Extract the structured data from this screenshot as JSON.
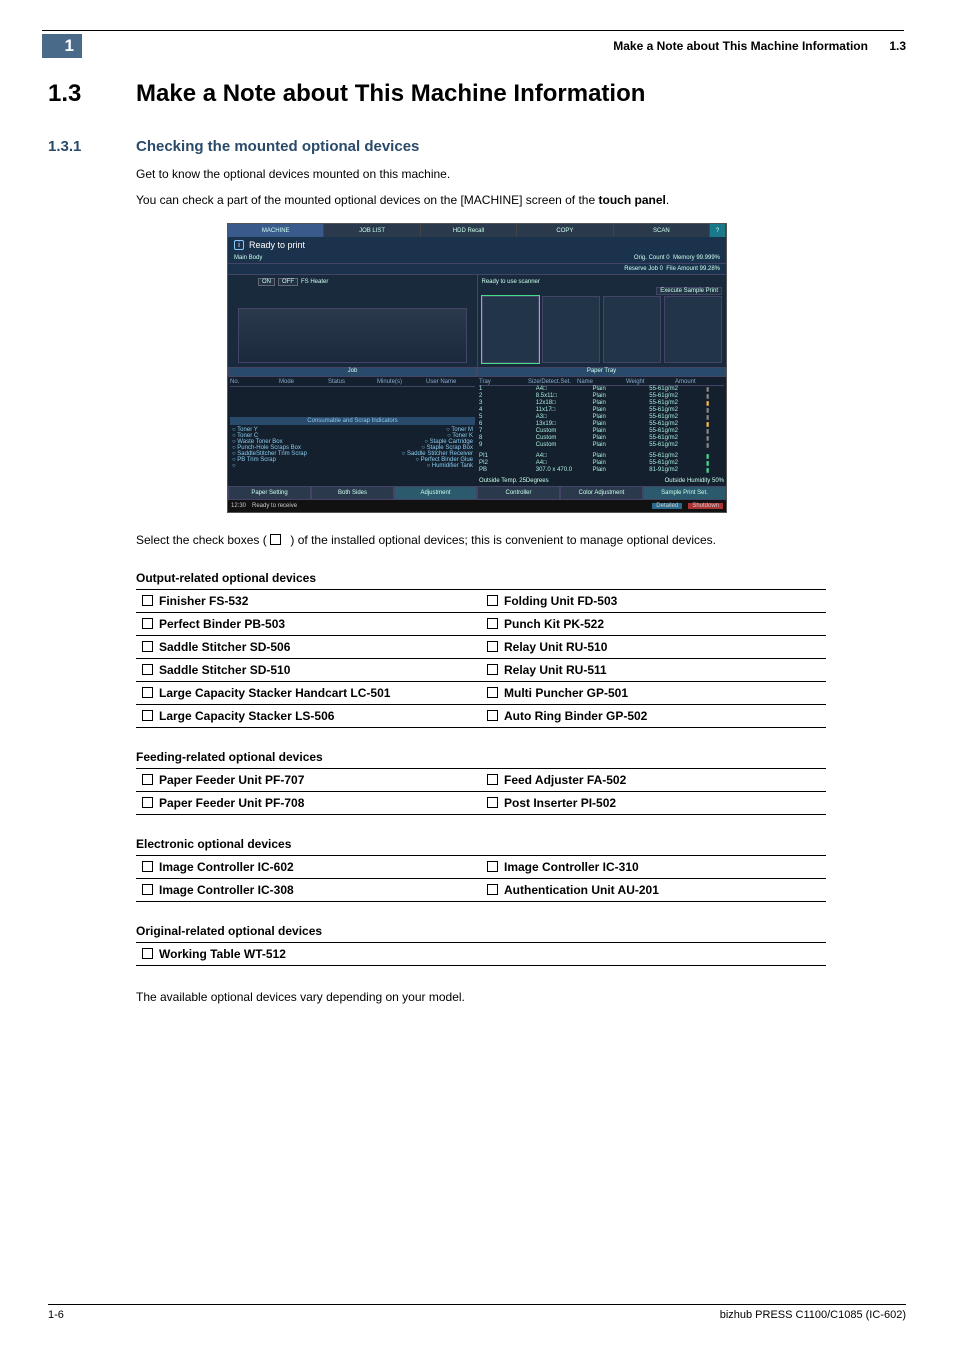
{
  "header": {
    "chapter_badge": "1",
    "running_title": "Make a Note about This Machine Information",
    "running_secnum": "1.3"
  },
  "h1": {
    "num": "1.3",
    "title": "Make a Note about This Machine Information"
  },
  "h2": {
    "num": "1.3.1",
    "title": "Checking the mounted optional devices"
  },
  "intro": {
    "p1": "Get to know the optional devices mounted on this machine.",
    "p2_a": "You can check a part of the mounted optional devices on the [MACHINE] screen of the ",
    "p2_bold": "touch panel",
    "p2_b": "."
  },
  "screenshot": {
    "tabs": [
      "MACHINE",
      "JOB LIST",
      "HDD Recall",
      "COPY",
      "SCAN"
    ],
    "help": "?",
    "ready_text": "Ready to print",
    "main_body_label": "Main Body",
    "orig_count_label": "Orig. Count",
    "orig_count_value": "0",
    "memory_label": "Memory",
    "memory_value": "99.999%",
    "reserve_job_label": "Reserve Job",
    "reserve_job_value": "0",
    "file_amount_label": "File Amount",
    "file_amount_value": "99.28%",
    "heater_label": "FS Heater",
    "heater_on": "ON",
    "heater_off": "OFF",
    "scanner_msg": "Ready to use scanner",
    "sample_btn": "Execute Sample Print",
    "job_header": "Job",
    "job_cols": [
      "No.",
      "Mode",
      "Status",
      "Minute(s)",
      "User Name"
    ],
    "paper_tray_header": "Paper Tray",
    "tray_cols": [
      "Tray",
      "Size/Detect.Set.",
      "Name",
      "Weight",
      "Amount"
    ],
    "trays": [
      {
        "n": "1",
        "size": "A4□",
        "name": "Plain",
        "wt": "55-61g/m2",
        "lvl": "gray"
      },
      {
        "n": "2",
        "size": "8.5x11□",
        "name": "Plain",
        "wt": "55-61g/m2",
        "lvl": "gray"
      },
      {
        "n": "3",
        "size": "12x18□",
        "name": "Plain",
        "wt": "55-61g/m2",
        "lvl": "warn"
      },
      {
        "n": "4",
        "size": "11x17□",
        "name": "Plain",
        "wt": "55-61g/m2",
        "lvl": "gray"
      },
      {
        "n": "5",
        "size": "A3□",
        "name": "Plain",
        "wt": "55-61g/m2",
        "lvl": "gray"
      },
      {
        "n": "6",
        "size": "13x19□",
        "name": "Plain",
        "wt": "55-61g/m2",
        "lvl": "warn"
      },
      {
        "n": "7",
        "size": "Custom",
        "name": "Plain",
        "wt": "55-61g/m2",
        "lvl": "gray"
      },
      {
        "n": "8",
        "size": "Custom",
        "name": "Plain",
        "wt": "55-61g/m2",
        "lvl": "gray"
      },
      {
        "n": "9",
        "size": "Custom",
        "name": "Plain",
        "wt": "55-61g/m2",
        "lvl": "gray"
      }
    ],
    "pi_trays": [
      {
        "n": "PI1",
        "size": "A4□",
        "name": "Plain",
        "wt": "55-61g/m2",
        "lvl": "ok"
      },
      {
        "n": "PI2",
        "size": "A4□",
        "name": "Plain",
        "wt": "55-61g/m2",
        "lvl": "ok"
      },
      {
        "n": "PB",
        "size": "307.0 x 470.0",
        "name": "Plain",
        "wt": "81-91g/m2",
        "lvl": "ok"
      }
    ],
    "consum_header": "Consumable and Scrap Indicators",
    "consum_items_l": [
      "Toner Y",
      "Toner C",
      "Waste Toner Box",
      "Punch-Hole Scraps Box",
      "SaddleStitcher Trim Scrap",
      "PB Trim Scrap"
    ],
    "consum_items_r": [
      "Toner M",
      "Toner K",
      "Staple Cartridge",
      "Staple Scrap Box",
      "Saddle Stitcher Receiver",
      "Perfect Binder Glue",
      "Humidifier Tank"
    ],
    "outside_temp_label": "Outside Temp.",
    "outside_temp_value": "25Degrees",
    "outside_hum_label": "Outside Humidity",
    "outside_hum_value": "50%",
    "bottom_buttons": [
      "Paper Setting",
      "Both Sides",
      "Adjustment",
      "Controller",
      "Color Adjustment",
      "Sample Print Set."
    ],
    "status_time": "12:30",
    "status_text": "Ready to receive",
    "status_detail": "Detailed",
    "status_shutdown": "Shutdown"
  },
  "after_ss": {
    "pre": "Select the check boxes ( ",
    "post": " ) of the installed optional devices; this is convenient to manage optional devices."
  },
  "groups": [
    {
      "label": "Output-related optional devices",
      "cols": 2,
      "rows": [
        [
          "Finisher FS-532",
          "Folding Unit FD-503"
        ],
        [
          "Perfect Binder PB-503",
          "Punch Kit PK-522"
        ],
        [
          "Saddle Stitcher SD-506",
          "Relay Unit RU-510"
        ],
        [
          "Saddle Stitcher SD-510",
          "Relay Unit RU-511"
        ],
        [
          "Large Capacity Stacker Handcart LC-501",
          "Multi Puncher GP-501"
        ],
        [
          "Large Capacity Stacker LS-506",
          "Auto Ring Binder GP-502"
        ]
      ]
    },
    {
      "label": "Feeding-related optional devices",
      "cols": 2,
      "rows": [
        [
          "Paper Feeder Unit PF-707",
          "Feed Adjuster FA-502"
        ],
        [
          "Paper Feeder Unit PF-708",
          "Post Inserter PI-502"
        ]
      ]
    },
    {
      "label": "Electronic optional devices",
      "cols": 2,
      "rows": [
        [
          "Image Controller IC-602",
          "Image Controller IC-310"
        ],
        [
          "Image Controller IC-308",
          "Authentication Unit AU-201"
        ]
      ]
    },
    {
      "label": "Original-related optional devices",
      "cols": 1,
      "rows": [
        [
          "Working Table WT-512"
        ]
      ]
    }
  ],
  "closing": "The available optional devices vary depending on your model.",
  "footer": {
    "left": "1-6",
    "right": "bizhub PRESS C1100/C1085 (IC-602)"
  }
}
